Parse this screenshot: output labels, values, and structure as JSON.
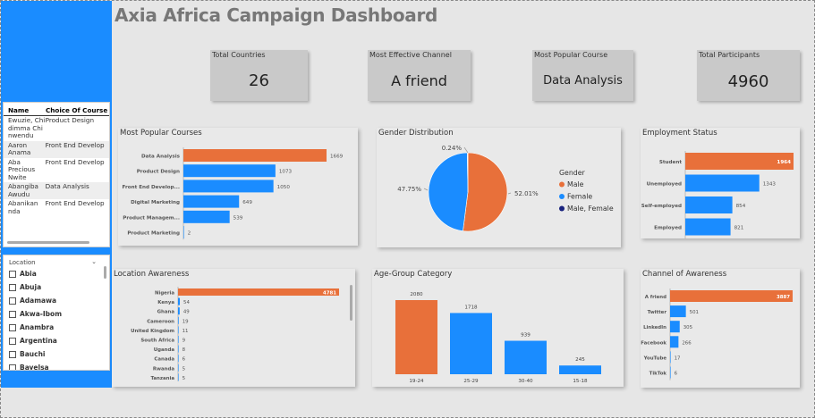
{
  "title": "Axia Africa Campaign Dashboard",
  "kpis": {
    "countries": {
      "label": "Total Countries",
      "value": "26"
    },
    "channel": {
      "label": "Most Effective Channel",
      "value": "A friend"
    },
    "course": {
      "label": "Most Popular Course",
      "value": "Data Analysis"
    },
    "participants": {
      "label": "Total Participants",
      "value": "4960"
    }
  },
  "table": {
    "headers": [
      "Name",
      "Choice Of Course"
    ],
    "rows": [
      {
        "name": "Ewuzie, Chidimma Chinwendu",
        "course": "Product Design"
      },
      {
        "name": "Aaron Anama",
        "course": "Front End Develop"
      },
      {
        "name": "Aba Precious Nwite",
        "course": "Front End Develop"
      },
      {
        "name": "Abangiba Awudu",
        "course": "Data Analysis"
      },
      {
        "name": "Abanikan nda",
        "course": "Front End Develop"
      }
    ]
  },
  "location_filter": {
    "title": "Location",
    "items": [
      "Abia",
      "Abuja",
      "Adamawa",
      "Akwa-Ibom",
      "Anambra",
      "Argentina",
      "Bauchi",
      "Bayelsa"
    ]
  },
  "colors": {
    "orange": "#e8703a",
    "blue": "#1a8cff",
    "navy": "#1a237e",
    "sidebar": "#1a8cff"
  },
  "chart_data": [
    {
      "id": "courses",
      "type": "bar",
      "orientation": "horizontal",
      "title": "Most Popular Courses",
      "categories": [
        "Data Analysis",
        "Product Design",
        "Front End Develop...",
        "Digital Marketing",
        "Product Managem...",
        "Product Marketing"
      ],
      "values": [
        1669,
        1073,
        1050,
        649,
        539,
        2
      ],
      "highlight_index": 0
    },
    {
      "id": "gender",
      "type": "pie",
      "title": "Gender Distribution",
      "legend_title": "Gender",
      "categories": [
        "Male",
        "Female",
        "Male, Female"
      ],
      "values": [
        52.01,
        47.75,
        0.24
      ],
      "labels": [
        "52.01%",
        "47.75%",
        "0.24%"
      ],
      "colors": [
        "#e8703a",
        "#1a8cff",
        "#1a237e"
      ]
    },
    {
      "id": "employment",
      "type": "bar",
      "orientation": "horizontal",
      "title": "Employment Status",
      "categories": [
        "Student",
        "Unemployed",
        "Self-employed",
        "Employed"
      ],
      "values": [
        1964,
        1343,
        854,
        821
      ],
      "highlight_index": 0
    },
    {
      "id": "location",
      "type": "bar",
      "orientation": "horizontal",
      "title": "Location Awareness",
      "categories": [
        "Nigeria",
        "Kenya",
        "Ghana",
        "Cameroon",
        "United Kingdom",
        "South Africa",
        "Uganda",
        "Canada",
        "Rwanda",
        "Tanzania"
      ],
      "values": [
        4781,
        54,
        49,
        19,
        11,
        9,
        8,
        6,
        5,
        5
      ],
      "highlight_index": 0
    },
    {
      "id": "age",
      "type": "bar",
      "orientation": "vertical",
      "title": "Age-Group Category",
      "categories": [
        "19-24",
        "25-29",
        "30-40",
        "15-18"
      ],
      "values": [
        2080,
        1718,
        939,
        245
      ],
      "highlight_index": 0
    },
    {
      "id": "awareness",
      "type": "bar",
      "orientation": "horizontal",
      "title": "Channel of Awareness",
      "categories": [
        "A friend",
        "Twitter",
        "LinkedIn",
        "Facebook",
        "YouTube",
        "TikTok"
      ],
      "values": [
        3887,
        501,
        305,
        266,
        17,
        6
      ],
      "highlight_index": 0
    }
  ]
}
